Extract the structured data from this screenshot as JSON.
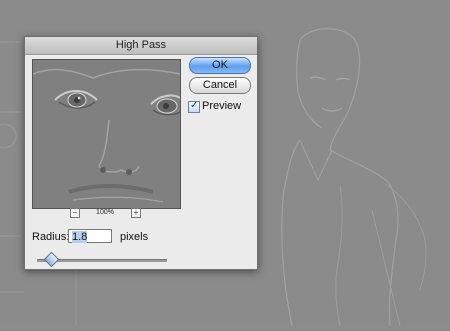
{
  "dialog": {
    "title": "High Pass",
    "ok_label": "OK",
    "cancel_label": "Cancel",
    "preview_label": "Preview",
    "preview_checked": true,
    "zoom_level": "100%",
    "zoom_out_glyph": "−",
    "zoom_in_glyph": "+",
    "radius_label": "Radius:",
    "radius_value": "1.8",
    "radius_unit": "pixels",
    "radius_slider_fraction": 0.08
  },
  "icons": {
    "checkmark": "✓"
  },
  "colors": {
    "accent_button": "#5f9ff0",
    "canvas_gray": "#8b8b8b"
  }
}
